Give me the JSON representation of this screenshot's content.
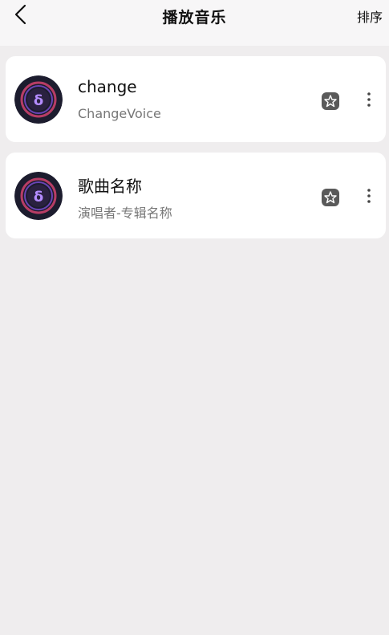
{
  "header": {
    "back_icon": "chevron-left-icon",
    "title": "播放音乐",
    "sort_label": "排序"
  },
  "songs": [
    {
      "title": "change",
      "subtitle": "ChangeVoice",
      "cover_icon": "music-disc-icon",
      "fav_icon": "star-outline-icon",
      "more_icon": "more-vertical-icon"
    },
    {
      "title": "歌曲名称",
      "subtitle": "演唱者-专辑名称",
      "cover_icon": "music-disc-icon",
      "fav_icon": "star-outline-icon",
      "more_icon": "more-vertical-icon"
    }
  ],
  "colors": {
    "background": "#efedee",
    "card": "#ffffff",
    "cover_dark": "#1c1c2e",
    "cover_ring": "#d2436f",
    "cover_accent": "#8a55f0",
    "icon_gray": "#5a5a5a"
  }
}
